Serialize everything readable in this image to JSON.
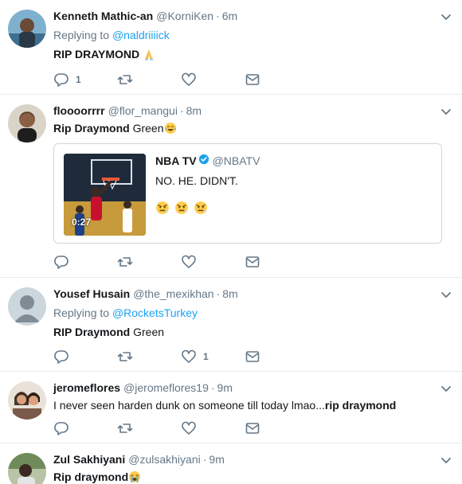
{
  "tweets": [
    {
      "name": "Kenneth Mathic-an",
      "handle": "@KorniKen",
      "time": "6m",
      "replying_label": "Replying to",
      "replying_to": "@naldriiiick",
      "text": "RIP DRAYMOND",
      "emoji": "folded-hands",
      "counts": {
        "reply": "1",
        "retweet": "",
        "like": ""
      }
    },
    {
      "name": "floooorrrr",
      "handle": "@flor_mangui",
      "time": "8m",
      "text_bold": "Rip Draymond",
      "text_rest": "Green",
      "emoji": "tears-of-joy",
      "quote": {
        "name": "NBA TV",
        "handle": "@NBATV",
        "text": "NO. HE. DIDN'T.",
        "emojis": [
          "angry-face",
          "angry-face",
          "angry-face"
        ],
        "video_duration": "0:27"
      },
      "counts": {
        "reply": "",
        "retweet": "",
        "like": ""
      }
    },
    {
      "name": "Yousef Husain",
      "handle": "@the_mexikhan",
      "time": "8m",
      "replying_label": "Replying to",
      "replying_to": "@RocketsTurkey",
      "text_bold": "RIP Draymond",
      "text_rest": "Green",
      "counts": {
        "reply": "",
        "retweet": "",
        "like": "1"
      }
    },
    {
      "name": "jeromeflores",
      "handle": "@jeromeflores19",
      "time": "9m",
      "text_plain": "I never seen harden dunk on someone till today lmao...",
      "text_bold": "rip draymond",
      "counts": {
        "reply": "",
        "retweet": "",
        "like": ""
      }
    },
    {
      "name": "Zul Sakhiyani",
      "handle": "@zulsakhiyani",
      "time": "9m",
      "text_bold": "Rip draymond",
      "emoji": "loudly-crying"
    }
  ],
  "colors": {
    "text": "#14171a",
    "secondary": "#657786",
    "link": "#1da1f2",
    "border": "#e6ecf0",
    "verified": "#1da1f2"
  },
  "icons": {
    "reply": "reply-icon",
    "retweet": "retweet-icon",
    "like": "heart-icon",
    "dm": "envelope-icon",
    "menu": "chevron-down-icon"
  }
}
